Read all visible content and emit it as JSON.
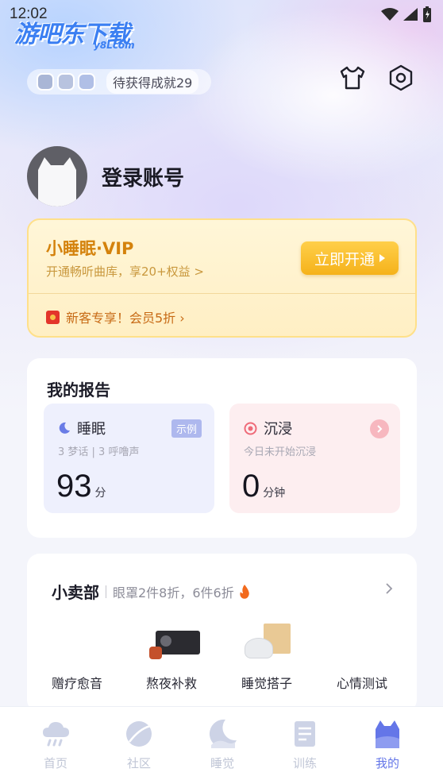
{
  "status_bar": {
    "time": "12:02"
  },
  "watermark": {
    "main": "游吧东下载",
    "sub": "y8Lcom"
  },
  "achievements": {
    "badge_count": 3,
    "label": "待获得成就29"
  },
  "profile": {
    "login_label": "登录账号"
  },
  "vip": {
    "title": "小睡眠·VIP",
    "subtitle": "开通畅听曲库，享20+权益 >",
    "button_label": "立即开通",
    "promo": "新客专享！会员5折 ›"
  },
  "report": {
    "title": "我的报告",
    "sleep": {
      "title": "睡眠",
      "tag": "示例",
      "meta": "3 梦话 | 3 呼噜声",
      "value": "93",
      "unit": "分"
    },
    "immerse": {
      "title": "沉浸",
      "meta": "今日未开始沉浸",
      "value": "0",
      "unit": "分钟"
    }
  },
  "shop": {
    "title": "小卖部",
    "subtitle": "眼罩2件8折，6件6折",
    "items": [
      "赠疗愈音",
      "熬夜补救",
      "睡觉搭子",
      "心情测试"
    ]
  },
  "tabs": [
    {
      "label": "首页",
      "icon": "cloud-rain-icon",
      "active": false
    },
    {
      "label": "社区",
      "icon": "planet-icon",
      "active": false
    },
    {
      "label": "睡觉",
      "icon": "moon-icon",
      "active": false
    },
    {
      "label": "训练",
      "icon": "notebook-icon",
      "active": false
    },
    {
      "label": "我的",
      "icon": "cat-icon",
      "active": true
    }
  ],
  "colors": {
    "accent": "#6476e8",
    "vip_gold": "#d4820c",
    "tab_inactive": "#c0c6d6"
  }
}
